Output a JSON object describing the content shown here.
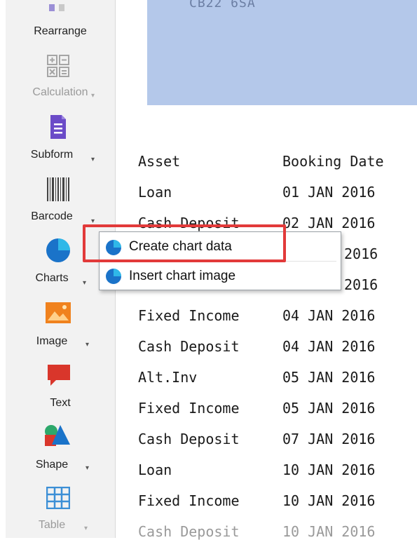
{
  "toolbar": {
    "items": [
      {
        "label": "Rearrange",
        "icon": "rearrange-icon",
        "has_caret": false,
        "disabled": false
      },
      {
        "label": "Calculation",
        "icon": "calculation-icon",
        "has_caret": false,
        "disabled": true
      },
      {
        "label": "Subform",
        "icon": "subform-icon",
        "has_caret": true,
        "disabled": false
      },
      {
        "label": "Barcode",
        "icon": "barcode-icon",
        "has_caret": true,
        "disabled": false
      },
      {
        "label": "Charts",
        "icon": "charts-icon",
        "has_caret": true,
        "disabled": false
      },
      {
        "label": "Image",
        "icon": "image-icon",
        "has_caret": true,
        "disabled": false
      },
      {
        "label": "Text",
        "icon": "text-icon",
        "has_caret": false,
        "disabled": false
      },
      {
        "label": "Shape",
        "icon": "shape-icon",
        "has_caret": true,
        "disabled": false
      },
      {
        "label": "Table",
        "icon": "table-icon",
        "has_caret": true,
        "disabled": true
      }
    ]
  },
  "document": {
    "postcode": "CB22 6SA",
    "headers": {
      "asset": "Asset",
      "booking_date": "Booking Date"
    },
    "rows": [
      {
        "asset": "Loan",
        "date": "01 JAN 2016"
      },
      {
        "asset": "Cash Deposit",
        "date": "02 JAN 2016"
      },
      {
        "asset": "",
        "date": "2016"
      },
      {
        "asset": "",
        "date": "2016"
      },
      {
        "asset": "Fixed Income",
        "date": "04 JAN 2016"
      },
      {
        "asset": "Cash Deposit",
        "date": "04 JAN 2016"
      },
      {
        "asset": "Alt.Inv",
        "date": "05 JAN 2016"
      },
      {
        "asset": "Fixed Income",
        "date": "05 JAN 2016"
      },
      {
        "asset": "Cash Deposit",
        "date": "07 JAN 2016"
      },
      {
        "asset": "Loan",
        "date": "10 JAN 2016"
      },
      {
        "asset": "Fixed Income",
        "date": "10 JAN 2016"
      },
      {
        "asset": "Cash Deposit",
        "date": "10 JAN 2016"
      }
    ]
  },
  "charts_menu": {
    "items": [
      {
        "label": "Create chart data",
        "icon": "pie-chart-icon",
        "highlighted": true
      },
      {
        "label": "Insert chart image",
        "icon": "pie-chart-icon",
        "highlighted": false
      }
    ]
  },
  "colors": {
    "highlight_border": "#e23a3a",
    "blue_band": "#b4c8ea",
    "chart_icon_blue": "#1a73c9",
    "subform_purple": "#6b4bc8",
    "image_orange": "#f0821e",
    "text_red": "#d9362b"
  }
}
